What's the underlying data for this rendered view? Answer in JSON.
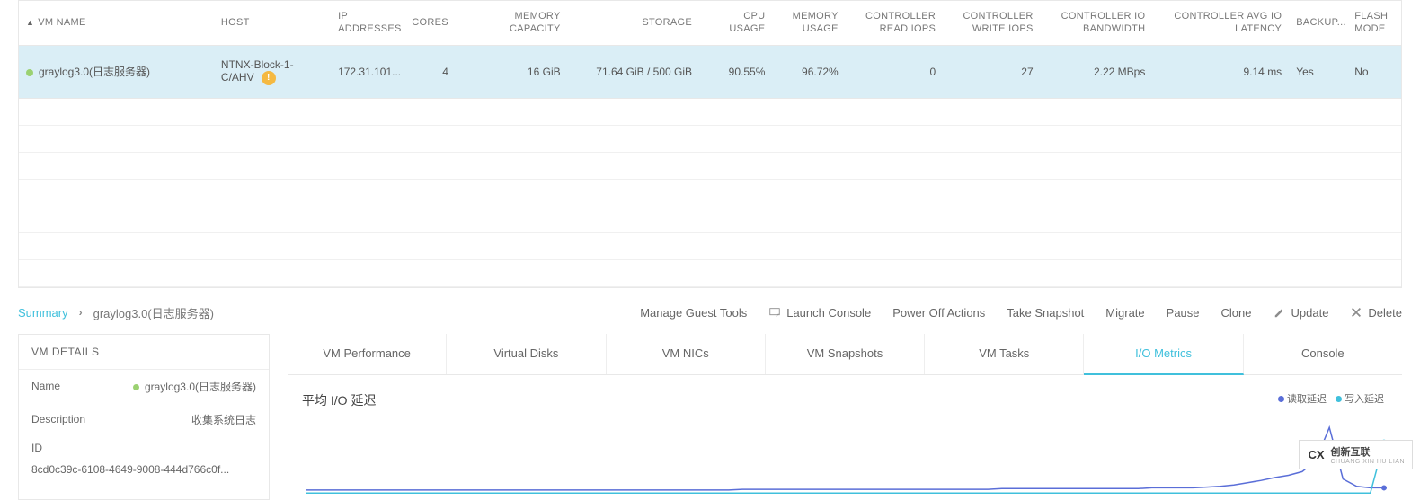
{
  "columns": {
    "vm_name": "VM NAME",
    "host": "HOST",
    "ip": "IP ADDRESSES",
    "cores": "CORES",
    "memory": "MEMORY CAPACITY",
    "storage": "STORAGE",
    "cpu_usage": "CPU USAGE",
    "memory_usage": "MEMORY USAGE",
    "ctrl_read_iops": "CONTROLLER READ IOPS",
    "ctrl_write_iops": "CONTROLLER WRITE IOPS",
    "ctrl_io_bw": "CONTROLLER IO BANDWIDTH",
    "ctrl_avg_io_lat": "CONTROLLER AVG IO LATENCY",
    "backup": "BACKUP...",
    "flash": "FLASH MODE"
  },
  "row": {
    "vm_name": "graylog3.0(日志服务器)",
    "host": "NTNX-Block-1-C/AHV",
    "host_warn_glyph": "!",
    "ip": "172.31.101...",
    "cores": "4",
    "memory": "16 GiB",
    "storage": "71.64 GiB / 500 GiB",
    "cpu_usage": "90.55%",
    "memory_usage": "96.72%",
    "ctrl_read_iops": "0",
    "ctrl_write_iops": "27",
    "ctrl_io_bw": "2.22 MBps",
    "ctrl_avg_io_lat": "9.14 ms",
    "backup": "Yes",
    "flash": "No"
  },
  "breadcrumb": {
    "summary": "Summary",
    "current": "graylog3.0(日志服务器)"
  },
  "actions": {
    "manage_guest_tools": "Manage Guest Tools",
    "launch_console": "Launch Console",
    "power_off": "Power Off Actions",
    "take_snapshot": "Take Snapshot",
    "migrate": "Migrate",
    "pause": "Pause",
    "clone": "Clone",
    "update": "Update",
    "delete": "Delete"
  },
  "vm_details": {
    "header": "VM DETAILS",
    "name_label": "Name",
    "name_value": "graylog3.0(日志服务器)",
    "desc_label": "Description",
    "desc_value": "收集系统日志",
    "id_label": "ID",
    "id_value": "8cd0c39c-6108-4649-9008-444d766c0f..."
  },
  "tabs": {
    "perf": "VM Performance",
    "disks": "Virtual Disks",
    "nics": "VM NICs",
    "snapshots": "VM Snapshots",
    "tasks": "VM Tasks",
    "io_metrics": "I/O Metrics",
    "console": "Console"
  },
  "chart": {
    "title": "平均 I/O 延迟",
    "legend_read": "读取延迟",
    "legend_write": "写入延迟"
  },
  "chart_data": {
    "type": "line",
    "title": "平均 I/O 延迟",
    "series": [
      {
        "name": "读取延迟",
        "color": "#5a6ed8",
        "values": [
          0.05,
          0.05,
          0.05,
          0.05,
          0.05,
          0.05,
          0.05,
          0.05,
          0.05,
          0.05,
          0.05,
          0.05,
          0.05,
          0.05,
          0.05,
          0.05,
          0.05,
          0.05,
          0.05,
          0.05,
          0.05,
          0.05,
          0.05,
          0.05,
          0.05,
          0.05,
          0.05,
          0.05,
          0.05,
          0.05,
          0.05,
          0.05,
          0.06,
          0.06,
          0.06,
          0.06,
          0.06,
          0.06,
          0.06,
          0.06,
          0.06,
          0.06,
          0.06,
          0.06,
          0.06,
          0.06,
          0.06,
          0.06,
          0.06,
          0.06,
          0.06,
          0.07,
          0.07,
          0.07,
          0.07,
          0.07,
          0.07,
          0.07,
          0.07,
          0.07,
          0.07,
          0.07,
          0.08,
          0.08,
          0.08,
          0.08,
          0.09,
          0.1,
          0.12,
          0.15,
          0.18,
          0.22,
          0.25,
          0.3,
          0.45,
          0.9,
          0.2,
          0.1,
          0.08,
          0.08
        ]
      },
      {
        "name": "写入延迟",
        "color": "#40c0dc",
        "values": [
          0.01,
          0.01,
          0.01,
          0.01,
          0.01,
          0.01,
          0.01,
          0.01,
          0.01,
          0.01,
          0.01,
          0.01,
          0.01,
          0.01,
          0.01,
          0.01,
          0.01,
          0.01,
          0.01,
          0.01,
          0.01,
          0.01,
          0.01,
          0.01,
          0.01,
          0.01,
          0.01,
          0.01,
          0.01,
          0.01,
          0.01,
          0.01,
          0.01,
          0.01,
          0.01,
          0.01,
          0.01,
          0.01,
          0.01,
          0.01,
          0.01,
          0.01,
          0.01,
          0.01,
          0.01,
          0.01,
          0.01,
          0.01,
          0.01,
          0.01,
          0.01,
          0.01,
          0.01,
          0.01,
          0.01,
          0.01,
          0.01,
          0.01,
          0.01,
          0.01,
          0.01,
          0.01,
          0.01,
          0.01,
          0.01,
          0.01,
          0.01,
          0.01,
          0.01,
          0.01,
          0.01,
          0.01,
          0.01,
          0.01,
          0.01,
          0.01,
          0.01,
          0.01,
          0.01,
          0.7
        ]
      }
    ]
  },
  "watermark": {
    "cn": "创新互联",
    "en": "CHUANG XIN HU LIAN",
    "logo": "CX"
  }
}
